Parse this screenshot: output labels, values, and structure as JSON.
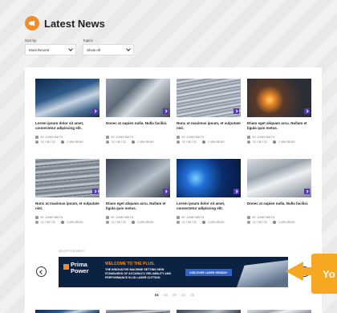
{
  "page_title": "Latest News",
  "filters": {
    "sort_label": "Sort by",
    "sort_value": "Most Recent",
    "topics_label": "Topics",
    "topics_value": "Show All"
  },
  "articles": [
    {
      "headline": "Lorem ipsum dolor sit amet, consectetur adipiscing elit.",
      "author": "BY JOHN SMITH",
      "date": "01 / 06 / 22",
      "read": "2 MIN READ"
    },
    {
      "headline": "Donec at sapien nulla. Nulla facilisi.",
      "author": "BY JOHN SMITH",
      "date": "01 / 06 / 22",
      "read": "2 MIN READ"
    },
    {
      "headline": "Nunc ut maximus ipsum, et vulputate nisl.",
      "author": "BY JOHN SMITH",
      "date": "01 / 06 / 22",
      "read": "2 MIN READ"
    },
    {
      "headline": "Etiam eget aliquam arcu. Nullam et ligula quis metus.",
      "author": "BY JOHN SMITH",
      "date": "01 / 06 / 22",
      "read": "2 MIN READ"
    },
    {
      "headline": "Nunc ut maximus ipsum, et vulputate nisl.",
      "author": "BY JOHN SMITH",
      "date": "01 / 06 / 22",
      "read": "2 MIN READ"
    },
    {
      "headline": "Etiam eget aliquam arcu. Nullam et ligula quis metus.",
      "author": "BY JOHN SMITH",
      "date": "01 / 06 / 22",
      "read": "2 MIN READ"
    },
    {
      "headline": "Lorem ipsum dolor sit amet, consectetur adipiscing elit.",
      "author": "BY JOHN SMITH",
      "date": "01 / 06 / 22",
      "read": "2 MIN READ"
    },
    {
      "headline": "Donec at sapien nulla. Nulla facilisi.",
      "author": "BY JOHN SMITH",
      "date": "01 / 06 / 22",
      "read": "2 MIN READ"
    }
  ],
  "ad": {
    "label": "ADVERTISEMENT",
    "logo_line1": "Prima",
    "logo_line2": "Power",
    "headline": "WELCOME TO THE PLUS.",
    "body": "THE INNOVATIVE MACHINE SETTING NEW STANDARDS OF ACCURACY, RELIABILITY AND PERFORMANCE IN 2D LASER CUTTING.",
    "cta": "DISCOVER LASER GENIUS+"
  },
  "pagination": [
    "01",
    "02",
    "03",
    "04",
    "05"
  ],
  "callout_text": "Yo",
  "colors": {
    "accent": "#f28c28",
    "badge": "#5b2bd6",
    "ad_bg": "#0c2242",
    "callout": "#f7a823"
  }
}
